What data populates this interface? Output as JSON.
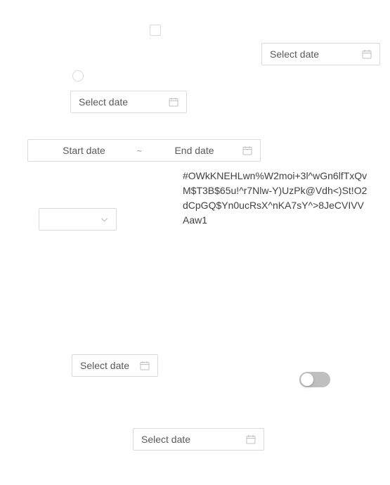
{
  "checkbox": {
    "checked": false
  },
  "radio": {
    "checked": false
  },
  "date_pickers": [
    {
      "placeholder": "Select date"
    },
    {
      "placeholder": "Select date"
    },
    {
      "placeholder": "Select date"
    },
    {
      "placeholder": "Select date"
    }
  ],
  "range_picker": {
    "start_placeholder": "Start date",
    "separator": "~",
    "end_placeholder": "End date"
  },
  "select": {
    "value": ""
  },
  "text_block": "#OWkKNEHLwn%W2moi+3l^wGn6lfTxQvM$T3B$65u!^r7Nlw-Y)UzPk@Vdh<)St!O2dCpGQ$Yn0ucRsX^nKA7sY^>8JeCVIVVAaw1",
  "switch": {
    "on": false
  },
  "icons": {
    "calendar": "calendar-icon",
    "chevron": "chevron-down-icon"
  },
  "colors": {
    "border": "#d9d9d9",
    "placeholder": "#595959",
    "switch_off": "#bfbfbf"
  }
}
